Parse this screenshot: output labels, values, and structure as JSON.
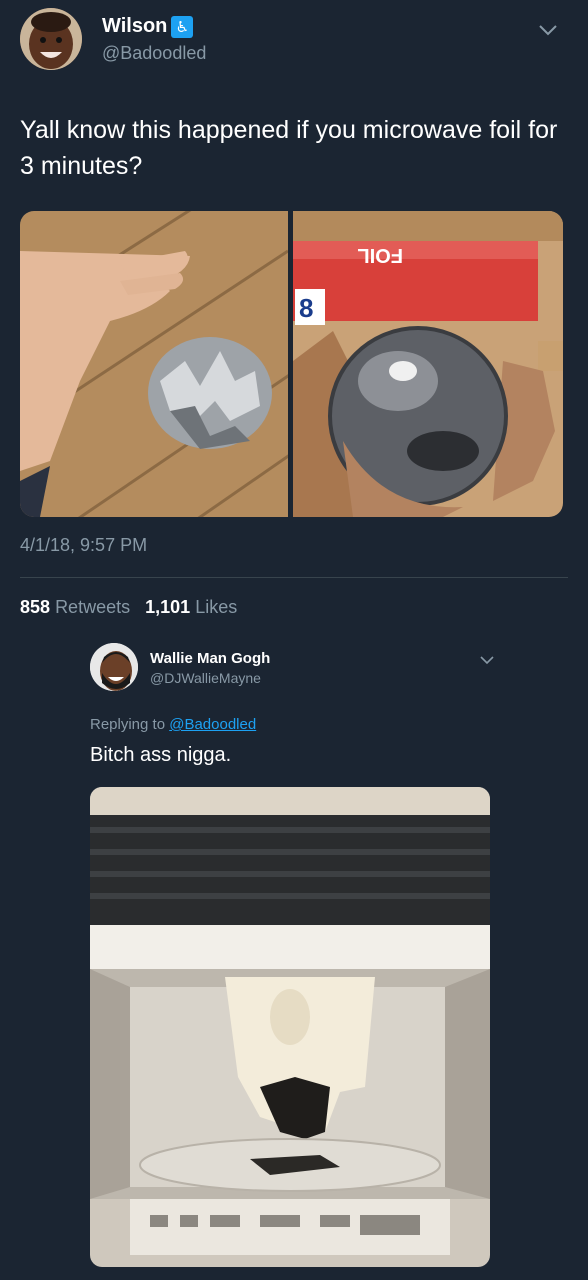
{
  "main_tweet": {
    "display_name": "Wilson",
    "handle": "@Badoodled",
    "text": "Yall know this happened if you microwave foil for 3 minutes?",
    "timestamp": "4/1/18, 9:57 PM",
    "retweets_count": "858",
    "retweets_label": "Retweets",
    "likes_count": "1,101",
    "likes_label": "Likes",
    "badge_icon": "wheelchair-icon"
  },
  "foil_box_label": "FOIL",
  "foil_box_number": "8",
  "reply": {
    "display_name": "Wallie Man Gogh",
    "handle": "@DJWallieMayne",
    "replying_prefix": "Replying to",
    "replying_to": "@Badoodled",
    "text": "Bitch ass nigga."
  },
  "colors": {
    "background": "#1b2532",
    "secondary_text": "#8899a6",
    "link": "#1da1f2",
    "divider": "#38444d"
  }
}
